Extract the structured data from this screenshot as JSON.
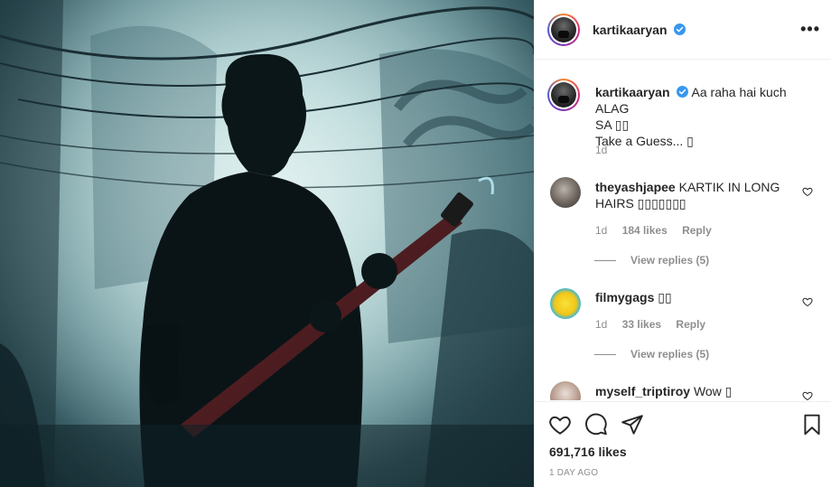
{
  "post": {
    "username": "kartikaaryan",
    "more_label": "•••",
    "likes": "691,716 likes",
    "timestamp": "1 DAY AGO"
  },
  "caption": {
    "username": "kartikaaryan",
    "text_line1": "Aa raha hai kuch ALAG",
    "text_line2": "SA ▯▯",
    "text_line3": "Take a Guess... ▯",
    "age": "1d"
  },
  "comments": [
    {
      "username": "theyashjapee",
      "text_line1": "KARTIK IN LONG",
      "text_line2": "HAIRS ▯▯▯▯▯▯▯",
      "age": "1d",
      "likes": "184 likes",
      "reply": "Reply",
      "view_replies": "View replies (5)"
    },
    {
      "username": "filmygags",
      "text_line1": "▯▯",
      "age": "1d",
      "likes": "33 likes",
      "reply": "Reply",
      "view_replies": "View replies (5)"
    },
    {
      "username": "myself_triptiroy",
      "text_line1": "Wow ▯"
    }
  ],
  "icons": {
    "like": "heart-icon",
    "comment": "comment-icon",
    "share": "paper-plane-icon",
    "save": "bookmark-icon",
    "verified": "verified-badge-icon",
    "more": "more-options-icon"
  },
  "colors": {
    "verified_blue": "#3897f0",
    "meta_gray": "#8e8e8e",
    "text": "#262626"
  }
}
